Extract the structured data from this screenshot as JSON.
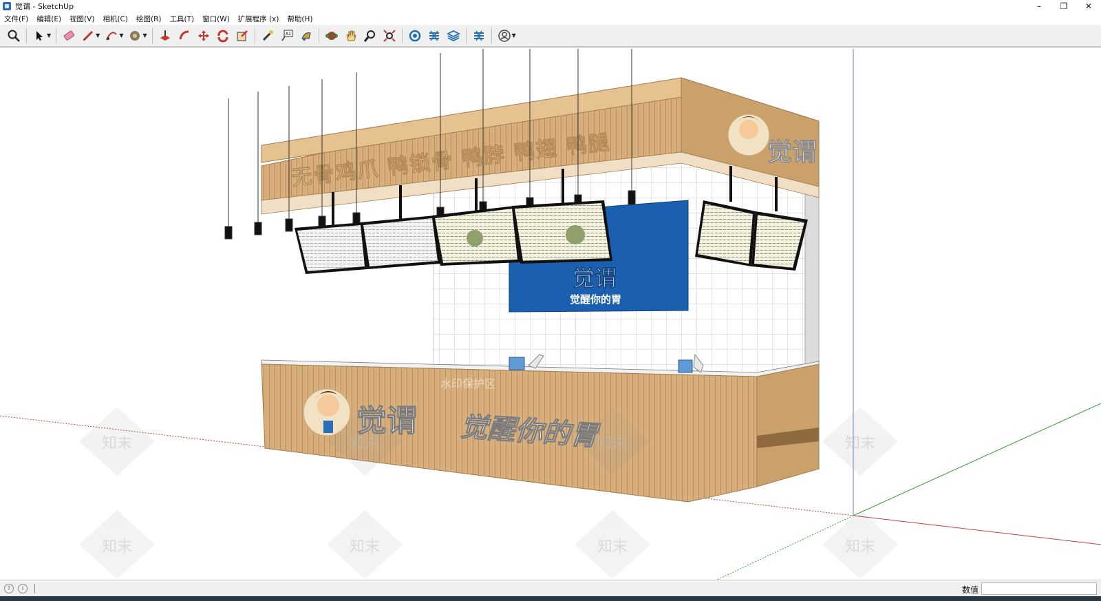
{
  "window": {
    "title": "觉谓 - SketchUp",
    "controls": {
      "minimize": "–",
      "restore": "❐",
      "close": "✕"
    }
  },
  "menubar": [
    "文件(F)",
    "编辑(E)",
    "视图(V)",
    "相机(C)",
    "绘图(R)",
    "工具(T)",
    "窗口(W)",
    "扩展程序 (x)",
    "帮助(H)"
  ],
  "toolbar": {
    "tools": [
      "zoom-window-icon",
      "select-icon",
      "eraser-icon",
      "pencil-icon",
      "arc-icon",
      "paint-bucket-icon",
      "push-pull-icon",
      "follow-me-icon",
      "move-icon",
      "rotate-icon",
      "scale-icon",
      "tape-measure-icon",
      "text-icon",
      "paint-icon",
      "orbit-icon",
      "pan-icon",
      "zoom-icon",
      "zoom-extents-icon",
      "warehouse-icon",
      "extension-warehouse-icon",
      "layers-icon",
      "components-icon",
      "account-icon"
    ]
  },
  "scene": {
    "header_slogan": "无骨鸡爪 鸭锁骨 鸭脖 鸭翅 鸭腿",
    "brand_name": "觉谓",
    "tagline": "觉醒你的胃",
    "panel_brand": "觉谓",
    "panel_tagline": "觉醒你的胃",
    "watermark_text": "水印保护区",
    "watermark_brand": "知末",
    "colors": {
      "wood": "#d8b07e",
      "wood_dark": "#b98e5b",
      "panel_blue": "#1a5fb0",
      "tile_line": "#c9c9c9",
      "axis_green": "#3a9a3a",
      "axis_red": "#c44040"
    }
  },
  "statusbar": {
    "measurements_label": "数值",
    "measurements_value": ""
  }
}
